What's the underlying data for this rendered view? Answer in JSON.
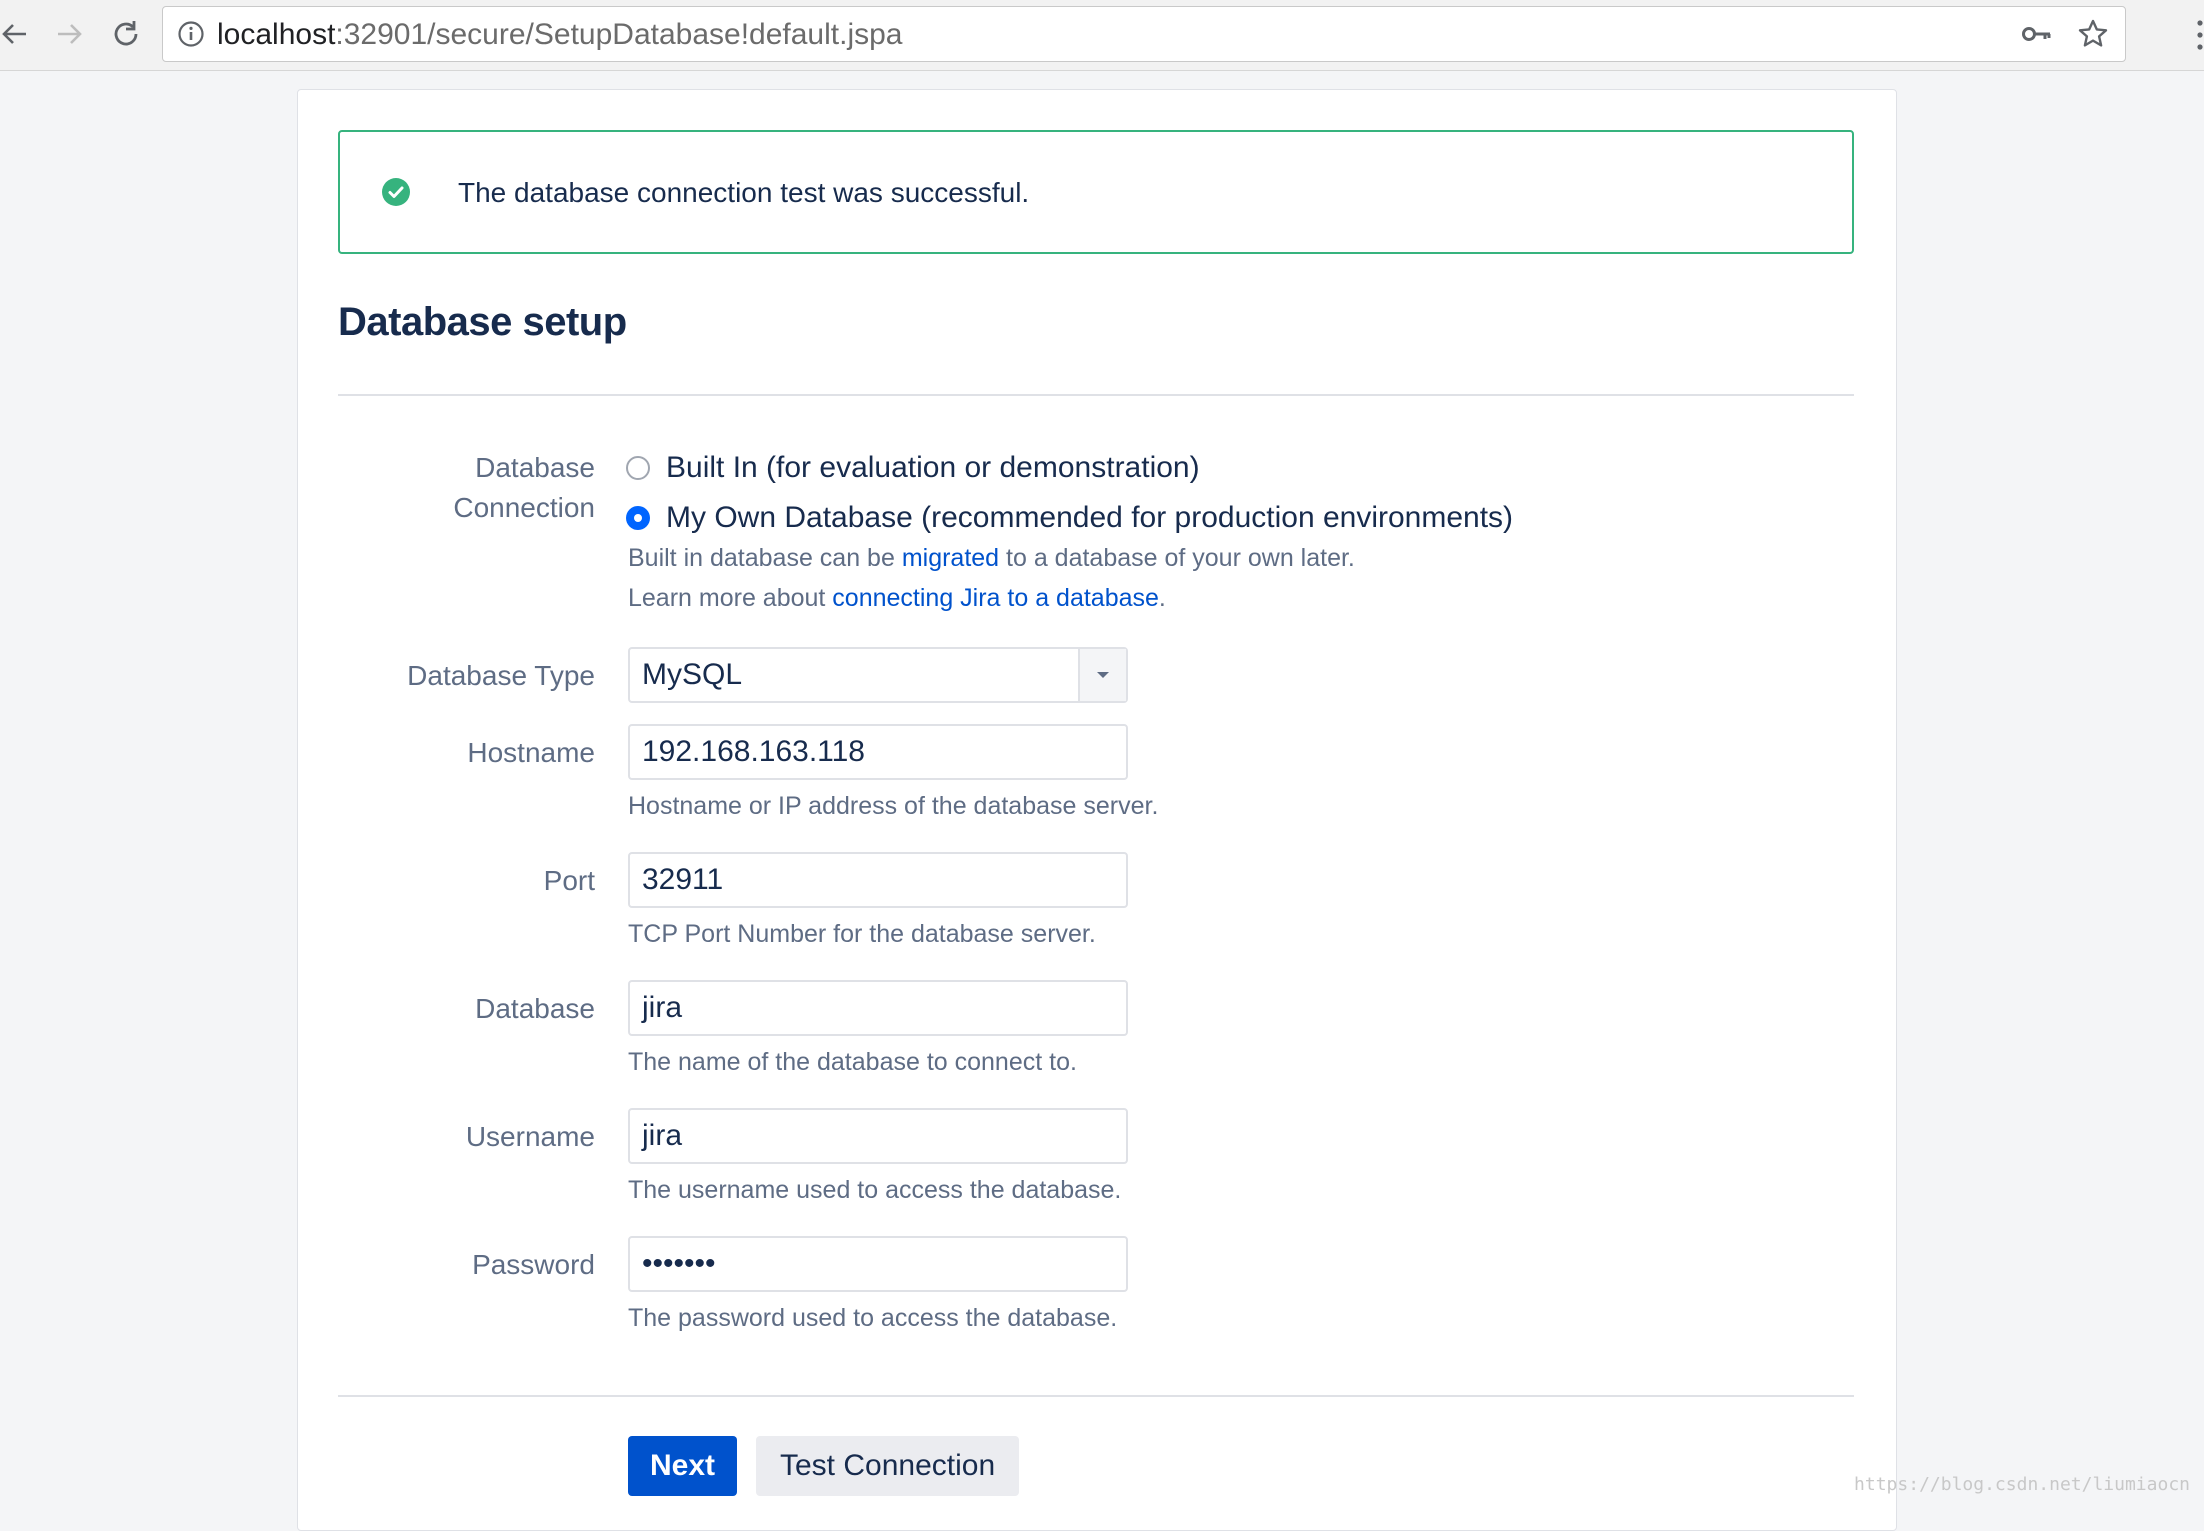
{
  "browser": {
    "url_host": "localhost",
    "url_path": ":32901/secure/SetupDatabase!default.jspa"
  },
  "banner": {
    "message": "The database connection test was successful."
  },
  "page": {
    "title": "Database setup"
  },
  "form": {
    "connection": {
      "label_line1": "Database",
      "label_line2": "Connection",
      "options": [
        {
          "label": "Built In (for evaluation or demonstration)",
          "selected": false
        },
        {
          "label": "My Own Database (recommended for production environments)",
          "selected": true
        }
      ],
      "help1_prefix": "Built in database can be ",
      "help1_link": "migrated",
      "help1_suffix": " to a database of your own later.",
      "help2_prefix": "Learn more about ",
      "help2_link": "connecting Jira to a database",
      "help2_suffix": "."
    },
    "database_type": {
      "label": "Database Type",
      "value": "MySQL"
    },
    "hostname": {
      "label": "Hostname",
      "value": "192.168.163.118",
      "help": "Hostname or IP address of the database server."
    },
    "port": {
      "label": "Port",
      "value": "32911",
      "help": "TCP Port Number for the database server."
    },
    "database": {
      "label": "Database",
      "value": "jira",
      "help": "The name of the database to connect to."
    },
    "username": {
      "label": "Username",
      "value": "jira",
      "help": "The username used to access the database."
    },
    "password": {
      "label": "Password",
      "value": "•••••••",
      "help": "The password used to access the database."
    }
  },
  "buttons": {
    "next": "Next",
    "test_connection": "Test Connection"
  },
  "watermark": "https://blog.csdn.net/liumiaocn",
  "colors": {
    "success": "#36b37e",
    "primary": "#0052cc",
    "link": "#0052cc"
  }
}
